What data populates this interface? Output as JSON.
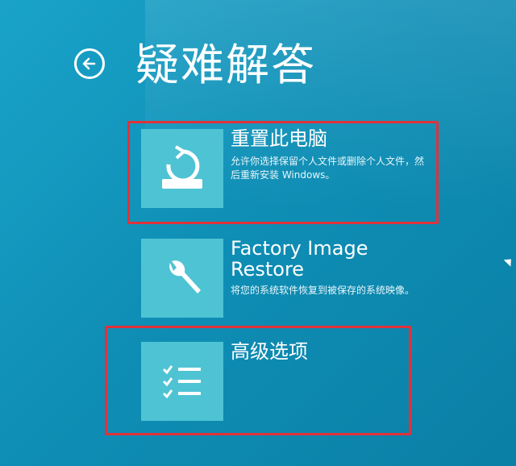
{
  "title": "疑难解答",
  "options": [
    {
      "title": "重置此电脑",
      "description": "允许你选择保留个人文件或删除个人文件，然后重新安装 Windows。",
      "icon": "reset-pc-icon"
    },
    {
      "title_line1": "Factory Image",
      "title_line2": "Restore",
      "description": "将您的系统软件恢复到被保存的系统映像。",
      "icon": "wrench-icon"
    },
    {
      "title": "高级选项",
      "description": "",
      "icon": "checklist-icon"
    }
  ],
  "colors": {
    "background": "#1597c0",
    "tile": "#4ec3d3",
    "highlight": "#e0323a"
  }
}
